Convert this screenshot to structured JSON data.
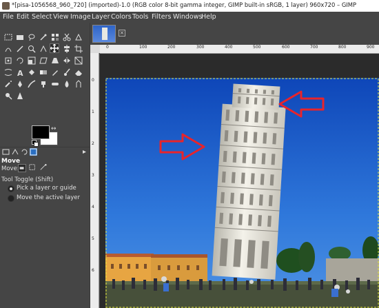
{
  "window": {
    "title": "*[pisa-1056568_960_720] (imported)-1.0 (RGB color 8-bit gamma integer, GIMP built-in sRGB, 1 layer) 960x720 – GIMP"
  },
  "menu": [
    "File",
    "Edit",
    "Select",
    "View",
    "Image",
    "Layer",
    "Colors",
    "Tools",
    "Filters",
    "Windows",
    "Help"
  ],
  "toolbox": {
    "tools": [
      "rect-select",
      "free-select",
      "lasso",
      "fuzzy-select",
      "paths",
      "color-picker",
      "crop",
      "scale",
      "zoom",
      "measure",
      "move",
      "align",
      "transform",
      "warp",
      "flip",
      "cage",
      "perspective",
      "heal",
      "clone",
      "smudge",
      "dodge",
      "bucket-fill",
      "blend",
      "pencil",
      "paintbrush",
      "eraser",
      "airbrush",
      "ink",
      "text",
      "mypaint",
      "convolve",
      "dodge-burn"
    ],
    "active_tool": "move"
  },
  "tool_options": {
    "title": "Move",
    "move_label": "Move:",
    "toggle_label": "Tool Toggle  (Shift)",
    "options": [
      {
        "label": "Pick a layer or guide",
        "checked": true
      },
      {
        "label": "Move the active layer",
        "checked": false
      }
    ]
  },
  "colors": {
    "foreground": "#000000",
    "background": "#ffffff"
  },
  "rulers": {
    "horizontal_labels": [
      "0",
      "100",
      "200",
      "300",
      "400",
      "500",
      "600",
      "700",
      "800",
      "900"
    ],
    "vertical_labels": [
      "0",
      "1",
      "2",
      "3",
      "4",
      "5",
      "6"
    ]
  },
  "canvas": {
    "image_name": "pisa-1056568_960_720",
    "guide_colors": [
      "#cc3333",
      "#3fa0b0"
    ],
    "arrow_color": "#e8242b"
  }
}
